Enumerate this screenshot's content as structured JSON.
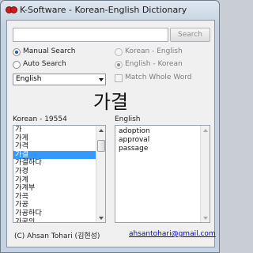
{
  "window": {
    "title": "K-Software - Korean-English Dictionary"
  },
  "search": {
    "placeholder": "",
    "value": "",
    "button_label": "Search"
  },
  "options": {
    "manual_search_label": "Manual Search",
    "auto_search_label": "Auto Search",
    "korean_english_label": "Korean - English",
    "english_korean_label": "English - Korean",
    "match_whole_word_label": "Match Whole Word",
    "language_selected": "English"
  },
  "display_word": "가결",
  "word_list": {
    "header": "Korean - 19554",
    "items": [
      "가",
      "가게",
      "가격",
      "가결",
      "가결하다",
      "가경",
      "가계",
      "가계부",
      "가곡",
      "가공",
      "가공하다",
      "가공의"
    ],
    "selected_index": 3
  },
  "meaning": {
    "header": "English",
    "lines": [
      "adoption",
      "approval",
      "passage"
    ]
  },
  "footer": {
    "credit": "(C) Ahsan Tohari (김현성)",
    "email": "ahsantohari@gmail.com"
  }
}
